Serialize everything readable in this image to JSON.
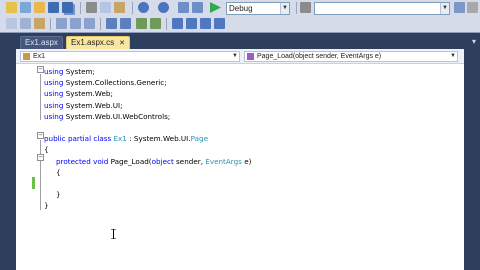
{
  "toolbar": {
    "config_combo": "Debug",
    "find_combo": "",
    "icons": [
      "new-project-icon",
      "add-item-icon",
      "open-icon",
      "save-icon",
      "save-all-icon",
      "cut-icon",
      "copy-icon",
      "paste-icon",
      "undo-icon",
      "redo-icon",
      "navigate-back-icon",
      "navigate-forward-icon",
      "start-debug-icon",
      "find-icon",
      "solution-explorer-icon",
      "properties-icon",
      "toolbox-icon"
    ]
  },
  "tabs": [
    {
      "label": "Ex1.aspx",
      "active": false
    },
    {
      "label": "Ex1.aspx.cs",
      "active": true
    }
  ],
  "nav": {
    "class_combo": "Ex1",
    "member_combo": "Page_Load(object sender, EventArgs e)"
  },
  "code": [
    {
      "indent": 0,
      "tokens": [
        {
          "t": "using",
          "c": "kw"
        },
        {
          "t": " System;"
        }
      ]
    },
    {
      "indent": 0,
      "tokens": [
        {
          "t": "using",
          "c": "kw"
        },
        {
          "t": " System.Collections.Generic;"
        }
      ]
    },
    {
      "indent": 0,
      "tokens": [
        {
          "t": "using",
          "c": "kw"
        },
        {
          "t": " System.Web;"
        }
      ]
    },
    {
      "indent": 0,
      "tokens": [
        {
          "t": "using",
          "c": "kw"
        },
        {
          "t": " System.Web.UI;"
        }
      ]
    },
    {
      "indent": 0,
      "tokens": [
        {
          "t": "using",
          "c": "kw"
        },
        {
          "t": " System.Web.UI.WebControls;"
        }
      ]
    },
    {
      "indent": 0,
      "tokens": []
    },
    {
      "indent": 0,
      "tokens": [
        {
          "t": "public",
          "c": "kw"
        },
        {
          "t": " "
        },
        {
          "t": "partial",
          "c": "kw"
        },
        {
          "t": " "
        },
        {
          "t": "class",
          "c": "kw"
        },
        {
          "t": " "
        },
        {
          "t": "Ex1",
          "c": "ty"
        },
        {
          "t": " : System.Web.UI."
        },
        {
          "t": "Page",
          "c": "ty"
        }
      ]
    },
    {
      "indent": 0,
      "tokens": [
        {
          "t": "{"
        }
      ]
    },
    {
      "indent": 1,
      "tokens": [
        {
          "t": "protected",
          "c": "kw"
        },
        {
          "t": " "
        },
        {
          "t": "void",
          "c": "kw"
        },
        {
          "t": " Page_Load("
        },
        {
          "t": "object",
          "c": "kw"
        },
        {
          "t": " sender, "
        },
        {
          "t": "EventArgs",
          "c": "ty"
        },
        {
          "t": " e)"
        }
      ]
    },
    {
      "indent": 1,
      "tokens": [
        {
          "t": "{"
        }
      ]
    },
    {
      "indent": 0,
      "tokens": []
    },
    {
      "indent": 1,
      "tokens": [
        {
          "t": "}"
        }
      ]
    },
    {
      "indent": 0,
      "tokens": [
        {
          "t": "}"
        }
      ]
    }
  ],
  "colors": {
    "keyword": "#0000ff",
    "type": "#2b91af",
    "ide_frame": "#2e3f5e",
    "active_tab": "#f7e7a3"
  }
}
